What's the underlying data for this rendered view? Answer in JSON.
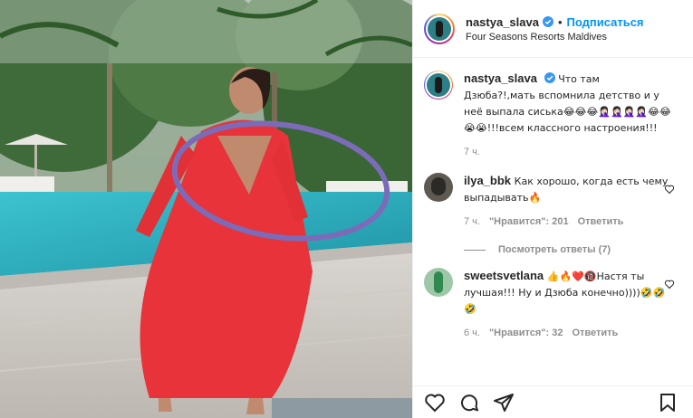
{
  "post": {
    "username": "nastya_slava",
    "follow_label": "Подписаться",
    "separator": "•",
    "location": "Four Seasons Resorts Maldives"
  },
  "caption": {
    "username": "nastya_slava",
    "text": "Что там Дзюба?!,мать вспомнила детство и у неё выпала сиська😂😂😂🤦🏻‍♀️🤦🏻‍♀️🤦🏻‍♀️🤦🏻‍♀️😂😂😭😭!!!всем классного настроения!!!",
    "time": "7 ч."
  },
  "comments": [
    {
      "username": "ilya_bbk",
      "text": "Как хорошо, когда есть чему выпадывать🔥",
      "time": "7 ч.",
      "likes": "\"Нравится\": 201",
      "reply": "Ответить"
    },
    {
      "username": "sweetsvetlana",
      "text": "👍🔥❤️🔞Настя ты лучшая!!! Ну и Дзюба конечно))))🤣🤣🤣",
      "time": "6 ч.",
      "likes": "\"Нравится\": 32",
      "reply": "Ответить"
    }
  ],
  "view_replies": "Посмотреть ответы (7)",
  "colors": {
    "accent": "#0095f6",
    "secondary_text": "#8e8e8e",
    "dress": "#e8333b",
    "pool": "#2ab6c4"
  },
  "icons": [
    "verified-icon",
    "heart-icon",
    "comment-icon",
    "share-icon",
    "bookmark-icon"
  ]
}
